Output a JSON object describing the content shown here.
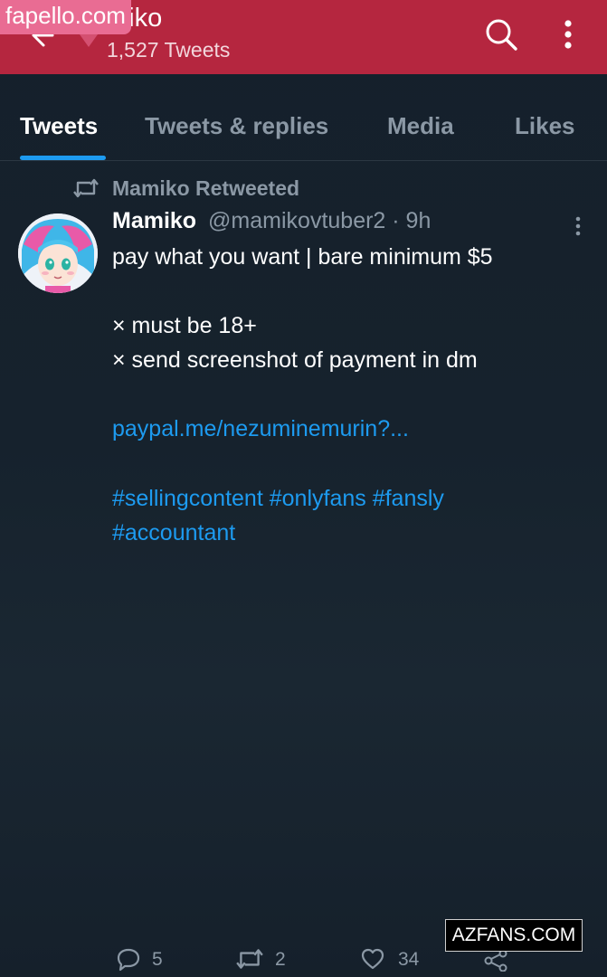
{
  "header": {
    "name": "miko",
    "tweet_count": "1,527 Tweets",
    "background": "#b5263f"
  },
  "watermarks": {
    "top": "fapello.com",
    "bottom": "AZFANS.COM"
  },
  "tabs": [
    {
      "label": "Tweets",
      "active": true
    },
    {
      "label": "Tweets & replies",
      "active": false
    },
    {
      "label": "Media",
      "active": false
    },
    {
      "label": "Likes",
      "active": false
    }
  ],
  "tweet": {
    "retweet_label": "Mamiko Retweeted",
    "author_name": "Mamiko",
    "author_handle": "@mamikovtuber2 · 9h",
    "lines": {
      "line1": "pay what you want | bare minimum $5",
      "line2": "× must be 18+",
      "line3": "× send screenshot of payment in dm",
      "link": "paypal.me/nezuminemurin?...",
      "hashtags1": "#sellingcontent #onlyfans #fansly",
      "hashtags2": "#accountant"
    },
    "actions": {
      "replies": "5",
      "retweets": "2",
      "likes": "34"
    }
  },
  "icons": {
    "back": "back-arrow-icon",
    "search": "search-icon",
    "more": "more-vertical-icon",
    "retweet": "retweet-icon",
    "reply": "reply-icon",
    "like": "heart-icon",
    "share": "share-icon"
  },
  "colors": {
    "background": "#15202b",
    "accent": "#1d9bf0",
    "muted": "#8b98a5"
  }
}
